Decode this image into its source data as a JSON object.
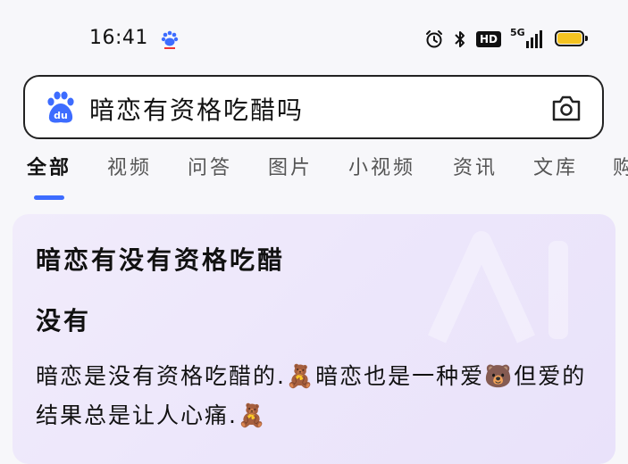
{
  "status_bar": {
    "time": "16:41",
    "network_label": "5G",
    "hd_label": "HD",
    "battery_color": "#f4c321"
  },
  "search": {
    "query": "暗恋有资格吃醋吗",
    "left_icon": "baidu-paw-icon",
    "right_icon": "camera-icon"
  },
  "tabs": [
    {
      "label": "全部",
      "active": true
    },
    {
      "label": "视频"
    },
    {
      "label": "问答"
    },
    {
      "label": "图片"
    },
    {
      "label": "小视频"
    },
    {
      "label": "资讯"
    },
    {
      "label": "文库"
    },
    {
      "label": "购"
    }
  ],
  "accent_color": "#3d6cff",
  "answer": {
    "title": "暗恋有没有资格吃醋",
    "short_answer": "没有",
    "body": "暗恋是没有资格吃醋的.🧸暗恋也是一种爱🐻但爱的结果总是让人心痛.🧸"
  }
}
